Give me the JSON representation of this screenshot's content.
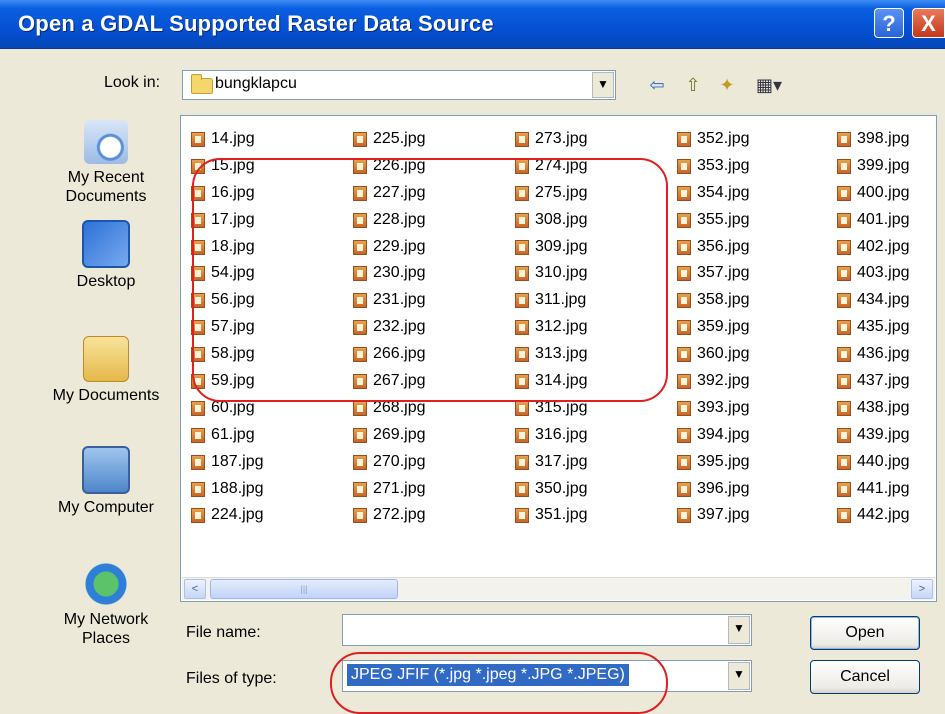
{
  "window": {
    "title": "Open a GDAL Supported Raster Data Source",
    "help_symbol": "?",
    "close_symbol": "X"
  },
  "toolbar": {
    "look_in_label": "Look in:",
    "current_folder": "bungklapcu",
    "dropdown_arrow": "▼",
    "back_glyph": "⇦",
    "up_glyph": "⇧",
    "newfolder_glyph": "✦",
    "views_glyph": "▦▾"
  },
  "places": [
    {
      "label": "My Recent Documents",
      "icon": "recent-documents-icon"
    },
    {
      "label": "Desktop",
      "icon": "desktop-icon"
    },
    {
      "label": "My Documents",
      "icon": "my-documents-icon"
    },
    {
      "label": "My Computer",
      "icon": "my-computer-icon"
    },
    {
      "label": "My Network Places",
      "icon": "network-places-icon"
    }
  ],
  "files": {
    "col1": [
      "14.jpg",
      "15.jpg",
      "16.jpg",
      "17.jpg",
      "18.jpg",
      "54.jpg",
      "56.jpg",
      "57.jpg",
      "58.jpg",
      "59.jpg",
      "60.jpg",
      "61.jpg",
      "187.jpg",
      "188.jpg",
      "224.jpg"
    ],
    "col2": [
      "225.jpg",
      "226.jpg",
      "227.jpg",
      "228.jpg",
      "229.jpg",
      "230.jpg",
      "231.jpg",
      "232.jpg",
      "266.jpg",
      "267.jpg",
      "268.jpg",
      "269.jpg",
      "270.jpg",
      "271.jpg",
      "272.jpg"
    ],
    "col3": [
      "273.jpg",
      "274.jpg",
      "275.jpg",
      "308.jpg",
      "309.jpg",
      "310.jpg",
      "311.jpg",
      "312.jpg",
      "313.jpg",
      "314.jpg",
      "315.jpg",
      "316.jpg",
      "317.jpg",
      "350.jpg",
      "351.jpg"
    ],
    "col4": [
      "352.jpg",
      "353.jpg",
      "354.jpg",
      "355.jpg",
      "356.jpg",
      "357.jpg",
      "358.jpg",
      "359.jpg",
      "360.jpg",
      "392.jpg",
      "393.jpg",
      "394.jpg",
      "395.jpg",
      "396.jpg",
      "397.jpg"
    ],
    "col5": [
      "398.jpg",
      "399.jpg",
      "400.jpg",
      "401.jpg",
      "402.jpg",
      "403.jpg",
      "434.jpg",
      "435.jpg",
      "436.jpg",
      "437.jpg",
      "438.jpg",
      "439.jpg",
      "440.jpg",
      "441.jpg",
      "442.jpg"
    ]
  },
  "scrollbar": {
    "left_arrow": "<",
    "right_arrow": ">",
    "thumb_grip": "|||"
  },
  "form": {
    "file_name_label": "File name:",
    "file_name_value": "",
    "files_of_type_label": "Files of type:",
    "files_of_type_value": "JPEG JFIF (*.jpg *.jpeg *.JPG *.JPEG)"
  },
  "buttons": {
    "open": "Open",
    "cancel": "Cancel"
  },
  "colors": {
    "annotation": "#e02020",
    "selection": "#316ac5",
    "title_bar": "#0550d4"
  }
}
